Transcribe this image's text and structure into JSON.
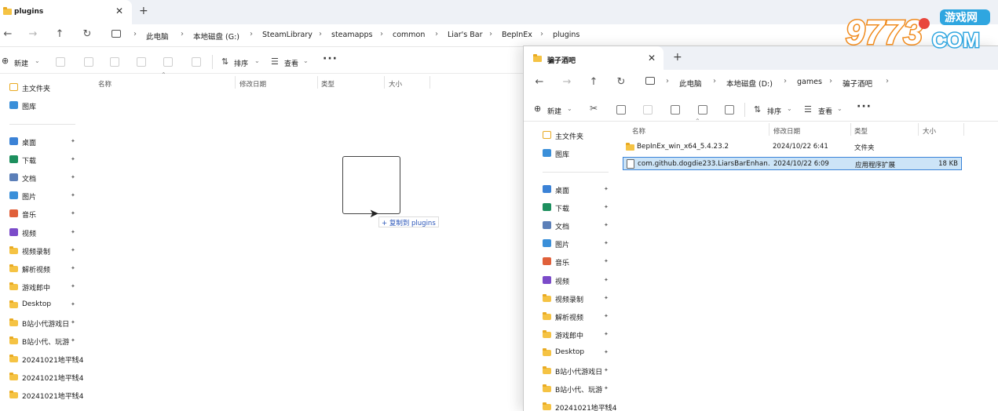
{
  "window_back": {
    "tab_title": "plugins",
    "address": [
      "此电脑",
      "本地磁盘 (G:)",
      "SteamLibrary",
      "steamapps",
      "common",
      "Liar's Bar",
      "BepInEx",
      "plugins"
    ],
    "toolbar": {
      "new": "新建",
      "sort": "排序",
      "view": "查看"
    },
    "columns": {
      "name": "名称",
      "modified": "修改日期",
      "type": "类型",
      "size": "大小"
    },
    "sidebar_top": [
      {
        "label": "主文件夹",
        "icon": "home-icon"
      },
      {
        "label": "图库",
        "icon": "gallery-icon"
      }
    ],
    "sidebar_quick": [
      {
        "label": "桌面",
        "icon": "desktop-icon",
        "color": "#3b82d6"
      },
      {
        "label": "下载",
        "icon": "download-icon",
        "color": "#1d8f5e"
      },
      {
        "label": "文档",
        "icon": "document-icon",
        "color": "#5b7fb8"
      },
      {
        "label": "图片",
        "icon": "pictures-icon",
        "color": "#3a8fd9"
      },
      {
        "label": "音乐",
        "icon": "music-icon",
        "color": "#e0603a"
      },
      {
        "label": "视频",
        "icon": "video-icon",
        "color": "#7b4bc9"
      },
      {
        "label": "视频录制",
        "icon": "folder-icon",
        "color": "#f5c344"
      },
      {
        "label": "解析视频",
        "icon": "folder-icon",
        "color": "#f5c344"
      },
      {
        "label": "游戏郎中",
        "icon": "folder-icon",
        "color": "#f5c344"
      },
      {
        "label": "Desktop",
        "icon": "folder-icon",
        "color": "#f5c344"
      },
      {
        "label": "B站小代游戏日",
        "icon": "folder-icon",
        "color": "#f5c344"
      },
      {
        "label": "B站小代、玩游",
        "icon": "folder-icon",
        "color": "#f5c344"
      },
      {
        "label": "20241021地平线4",
        "icon": "folder-icon",
        "color": "#f5c344"
      },
      {
        "label": "20241021地平线4",
        "icon": "folder-icon",
        "color": "#f5c344"
      },
      {
        "label": "20241021地平线4",
        "icon": "folder-icon",
        "color": "#f5c344"
      }
    ],
    "drag_tip": "+ 复制到 plugins"
  },
  "window_front": {
    "tab_title": "骗子酒吧",
    "address": [
      "此电脑",
      "本地磁盘 (D:)",
      "games",
      "骗子酒吧"
    ],
    "toolbar": {
      "new": "新建",
      "sort": "排序",
      "view": "查看"
    },
    "columns": {
      "name": "名称",
      "modified": "修改日期",
      "type": "类型",
      "size": "大小"
    },
    "files": [
      {
        "name": "BepInEx_win_x64_5.4.23.2",
        "modified": "2024/10/22 6:41",
        "type": "文件夹",
        "size": "",
        "kind": "folder",
        "selected": false
      },
      {
        "name": "com.github.dogdie233.LiarsBarEnhan...",
        "modified": "2024/10/22 6:09",
        "type": "应用程序扩展",
        "size": "18 KB",
        "kind": "dll",
        "selected": true
      }
    ],
    "sidebar_top": [
      {
        "label": "主文件夹",
        "icon": "home-icon"
      },
      {
        "label": "图库",
        "icon": "gallery-icon"
      }
    ],
    "sidebar_quick": [
      {
        "label": "桌面",
        "icon": "desktop-icon",
        "color": "#3b82d6"
      },
      {
        "label": "下载",
        "icon": "download-icon",
        "color": "#1d8f5e"
      },
      {
        "label": "文档",
        "icon": "document-icon",
        "color": "#5b7fb8"
      },
      {
        "label": "图片",
        "icon": "pictures-icon",
        "color": "#3a8fd9"
      },
      {
        "label": "音乐",
        "icon": "music-icon",
        "color": "#e0603a"
      },
      {
        "label": "视频",
        "icon": "video-icon",
        "color": "#7b4bc9"
      },
      {
        "label": "视频录制",
        "icon": "folder-icon",
        "color": "#f5c344"
      },
      {
        "label": "解析视频",
        "icon": "folder-icon",
        "color": "#f5c344"
      },
      {
        "label": "游戏郎中",
        "icon": "folder-icon",
        "color": "#f5c344"
      },
      {
        "label": "Desktop",
        "icon": "folder-icon",
        "color": "#f5c344"
      },
      {
        "label": "B站小代游戏日",
        "icon": "folder-icon",
        "color": "#f5c344"
      },
      {
        "label": "B站小代、玩游",
        "icon": "folder-icon",
        "color": "#f5c344"
      },
      {
        "label": "20241021地平线4",
        "icon": "folder-icon",
        "color": "#f5c344"
      }
    ]
  },
  "watermark": {
    "text_main": "9773",
    "text_badge": "游戏网",
    "text_sub": "COM"
  },
  "colors": {
    "accent": "#3a83d8",
    "selection": "#cce4f7",
    "folder": "#f5c344",
    "tabbar": "#eef1f6"
  }
}
